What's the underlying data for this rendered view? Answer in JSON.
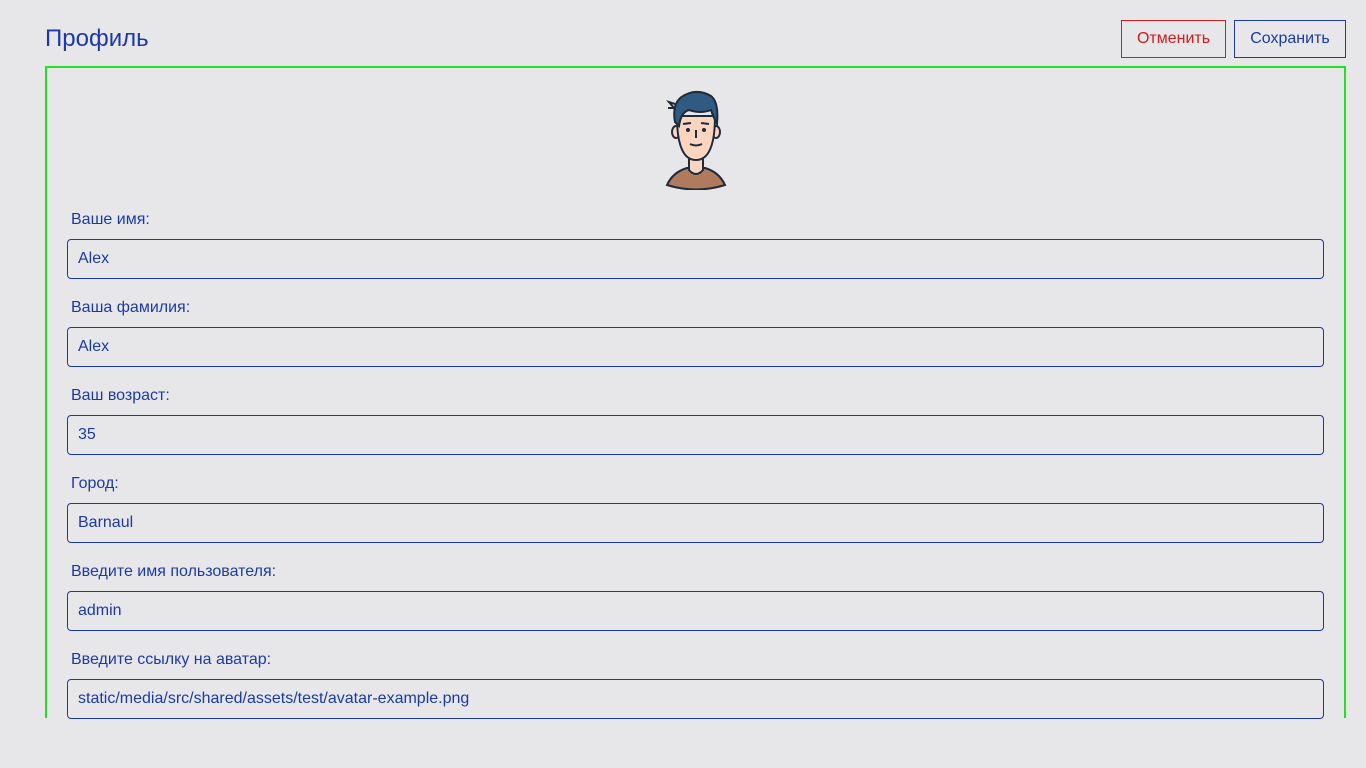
{
  "header": {
    "title": "Профиль",
    "cancel_label": "Отменить",
    "save_label": "Сохранить"
  },
  "colors": {
    "accent": "#1b3aa8",
    "danger": "#d21b1b",
    "card_border": "#22e022",
    "background": "#e7e7ea"
  },
  "profile": {
    "avatar_icon": "avatar-icon",
    "fields": [
      {
        "label": "Ваше имя:",
        "value": "Alex"
      },
      {
        "label": "Ваша фамилия:",
        "value": "Alex"
      },
      {
        "label": "Ваш возраст:",
        "value": "35"
      },
      {
        "label": "Город:",
        "value": "Barnaul"
      },
      {
        "label": "Введите имя пользователя:",
        "value": "admin"
      },
      {
        "label": "Введите ссылку на аватар:",
        "value": "static/media/src/shared/assets/test/avatar-example.png"
      }
    ]
  }
}
